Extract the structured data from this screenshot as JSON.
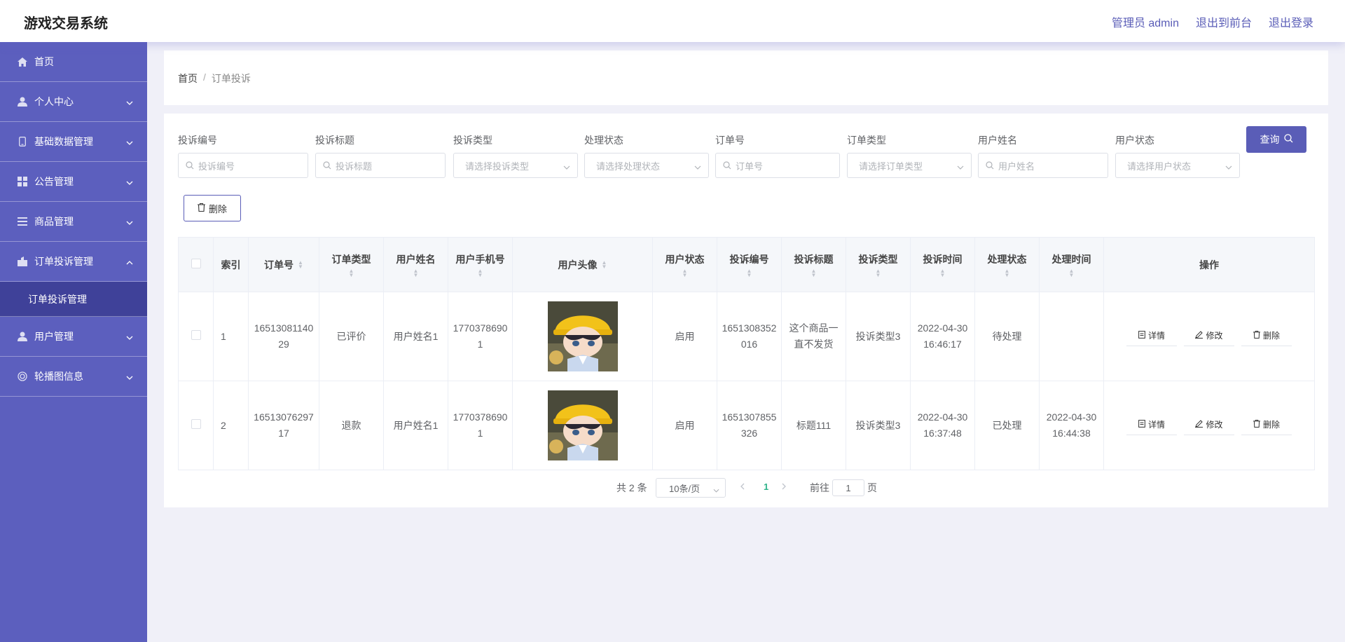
{
  "app": {
    "title": "游戏交易系统"
  },
  "header": {
    "links": [
      "管理员 admin",
      "退出到前台",
      "退出登录"
    ]
  },
  "sidebar": {
    "items": [
      {
        "label": "首页",
        "icon": "home-icon",
        "has_arrow": false
      },
      {
        "label": "个人中心",
        "icon": "user-icon",
        "has_arrow": true
      },
      {
        "label": "基础数据管理",
        "icon": "phone-icon",
        "has_arrow": true
      },
      {
        "label": "公告管理",
        "icon": "grid-icon",
        "has_arrow": true
      },
      {
        "label": "商品管理",
        "icon": "list-icon",
        "has_arrow": true
      },
      {
        "label": "订单投诉管理",
        "icon": "bag-icon",
        "has_arrow": true,
        "expanded": true,
        "children": [
          {
            "label": "订单投诉管理"
          }
        ]
      },
      {
        "label": "用户管理",
        "icon": "user-icon",
        "has_arrow": true
      },
      {
        "label": "轮播图信息",
        "icon": "circle-icon",
        "has_arrow": true
      }
    ]
  },
  "breadcrumb": {
    "home": "首页",
    "separator": "/",
    "current": "订单投诉"
  },
  "filters": [
    {
      "label": "投诉编号",
      "placeholder": "投诉编号",
      "type": "input"
    },
    {
      "label": "投诉标题",
      "placeholder": "投诉标题",
      "type": "input"
    },
    {
      "label": "投诉类型",
      "placeholder": "请选择投诉类型",
      "type": "select"
    },
    {
      "label": "处理状态",
      "placeholder": "请选择处理状态",
      "type": "select"
    },
    {
      "label": "订单号",
      "placeholder": "订单号",
      "type": "input"
    },
    {
      "label": "订单类型",
      "placeholder": "请选择订单类型",
      "type": "select"
    },
    {
      "label": "用户姓名",
      "placeholder": "用户姓名",
      "type": "input"
    },
    {
      "label": "用户状态",
      "placeholder": "请选择用户状态",
      "type": "select"
    }
  ],
  "actions": {
    "query": "查询",
    "delete": "删除"
  },
  "table": {
    "columns": [
      "索引",
      "订单号",
      "订单类型",
      "用户姓名",
      "用户手机号",
      "用户头像",
      "用户状态",
      "投诉编号",
      "投诉标题",
      "投诉类型",
      "投诉时间",
      "处理状态",
      "处理时间",
      "操作"
    ],
    "rows": [
      {
        "index": "1",
        "order_no": "1651308114029",
        "order_type": "已评价",
        "user_name": "用户姓名1",
        "phone": "17703786901",
        "user_status": "启用",
        "complaint_no": "1651308352016",
        "complaint_title": "这个商品一直不发货",
        "complaint_type": "投诉类型3",
        "complaint_time": "2022-04-30 16:46:17",
        "process_status": "待处理",
        "process_time": ""
      },
      {
        "index": "2",
        "order_no": "1651307629717",
        "order_type": "退款",
        "user_name": "用户姓名1",
        "phone": "17703786901",
        "user_status": "启用",
        "complaint_no": "1651307855326",
        "complaint_title": "标题111",
        "complaint_type": "投诉类型3",
        "complaint_time": "2022-04-30 16:37:48",
        "process_status": "已处理",
        "process_time": "2022-04-30 16:44:38"
      }
    ],
    "row_actions": [
      "详情",
      "修改",
      "删除"
    ]
  },
  "pagination": {
    "total": "共 2 条",
    "page_size": "10条/页",
    "current_page": "1",
    "goto": "前往",
    "goto_value": "1",
    "unit": "页"
  },
  "colors": {
    "accent": "#5a5db7",
    "sidebar": "#5c5fbe",
    "submenu_active": "#3f4199",
    "page_active": "#2fb38a"
  }
}
